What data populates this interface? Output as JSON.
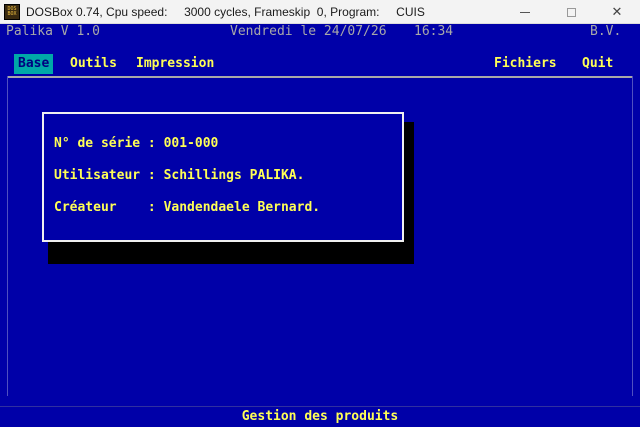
{
  "window": {
    "title": "DOSBox 0.74, Cpu speed:     3000 cycles, Frameskip  0, Program:     CUIS",
    "icon_name": "dosbox-icon",
    "controls": {
      "minimize": "minimize",
      "maximize": "maximize",
      "close": "✕"
    }
  },
  "topbar": {
    "app_name": "Palika V 1.0",
    "date": "Vendredi le 24/07/26",
    "time": "16:34",
    "company": "B.V."
  },
  "menu": {
    "items": [
      {
        "label": "Base",
        "active": true
      },
      {
        "label": "Outils"
      },
      {
        "label": "Impression"
      },
      {
        "label": "Fichiers"
      },
      {
        "label": "Quit"
      }
    ]
  },
  "info_dialog": {
    "serial_line": "N° de série : 001-000",
    "user_line": "Utilisateur : Schillings PALIKA.",
    "creator_line": "Créateur    : Vandendaele Bernard."
  },
  "status": {
    "text": "Gestion des produits"
  },
  "colors": {
    "screen_bg": "#0000a8",
    "highlight_text": "#ffff55",
    "dim_text": "#a8a8a8",
    "menu_active_bg": "#00a8a8"
  }
}
